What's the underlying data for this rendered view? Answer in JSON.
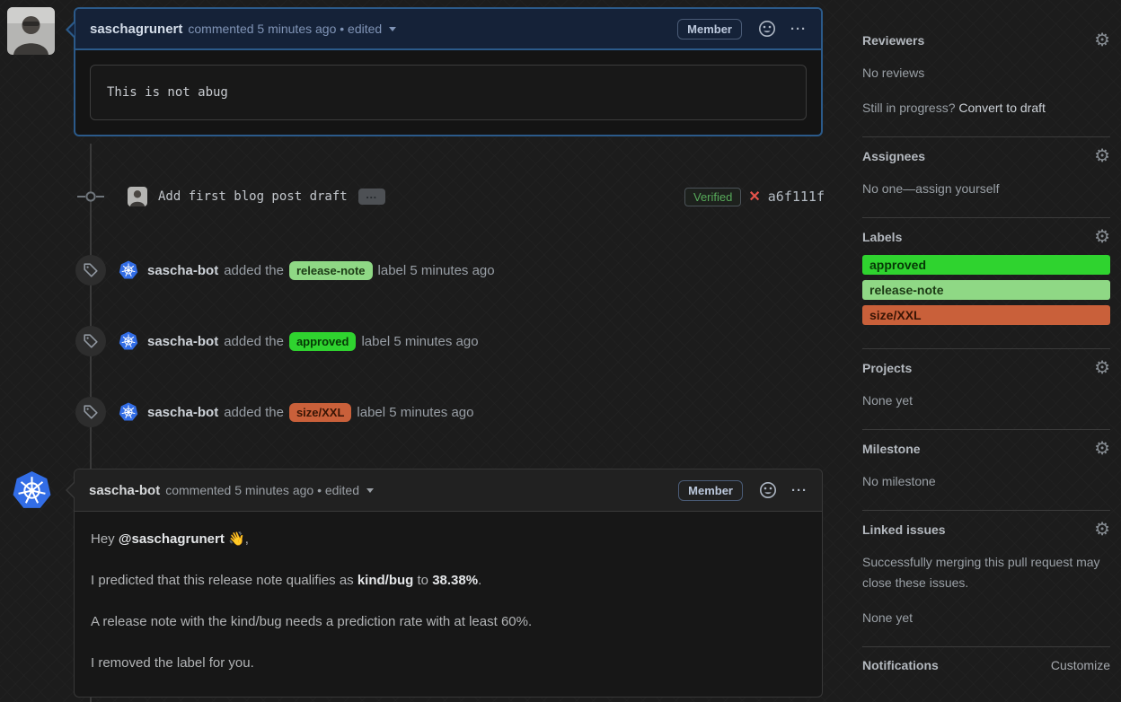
{
  "colors": {
    "highlight_border": "#2b5a8a",
    "k8s_blue": "#326de6",
    "verified_green": "#57ab5a",
    "error_red": "#e5534b"
  },
  "icons": {
    "gear": "⚙",
    "kebab": "···",
    "expander": "…",
    "status_x": "✕"
  },
  "comment1": {
    "author": "saschagrunert",
    "meta": "commented 5 minutes ago • edited",
    "badge": "Member",
    "code": "This is not abug"
  },
  "commit": {
    "message": "Add first blog post draft",
    "verified_label": "Verified",
    "sha": "a6f111f"
  },
  "events": [
    {
      "actor": "sascha-bot",
      "action": "added the",
      "label": "release-note",
      "suffix": "label 5 minutes ago",
      "label_style": "background:#8fd885;color:#1c3a15"
    },
    {
      "actor": "sascha-bot",
      "action": "added the",
      "label": "approved",
      "suffix": "label 5 minutes ago",
      "label_style": "background:#2fd32f;color:#063806"
    },
    {
      "actor": "sascha-bot",
      "action": "added the",
      "label": "size/XXL",
      "suffix": "label 5 minutes ago",
      "label_style": "background:#c9603a;color:#391505"
    }
  ],
  "comment2": {
    "author": "sascha-bot",
    "meta": "commented 5 minutes ago • edited",
    "badge": "Member",
    "p1_pre": "Hey ",
    "p1_mention": "@saschagrunert",
    "p1_emoji": " 👋",
    "p1_post": ",",
    "p2_a": "I predicted that this release note qualifies as ",
    "p2_b": "kind/bug",
    "p2_c": " to ",
    "p2_d": "38.38%",
    "p2_e": ".",
    "p3": "A release note with the kind/bug needs a prediction rate with at least 60%.",
    "p4": "I removed the label for you."
  },
  "sidebar": {
    "reviewers": {
      "title": "Reviewers",
      "empty": "No reviews",
      "prompt": "Still in progress? ",
      "link": "Convert to draft"
    },
    "assignees": {
      "title": "Assignees",
      "empty_pre": "No one—",
      "empty_link": "assign yourself"
    },
    "labels": {
      "title": "Labels",
      "items": [
        {
          "name": "approved",
          "style": "background:#2fd32f;color:#063806"
        },
        {
          "name": "release-note",
          "style": "background:#8fd885;color:#1c3a15"
        },
        {
          "name": "size/XXL",
          "style": "background:#c9603a;color:#391505"
        }
      ]
    },
    "projects": {
      "title": "Projects",
      "empty": "None yet"
    },
    "milestone": {
      "title": "Milestone",
      "empty": "No milestone"
    },
    "linked_issues": {
      "title": "Linked issues",
      "description": "Successfully merging this pull request may close these issues.",
      "empty": "None yet"
    },
    "notifications": {
      "title": "Notifications",
      "link": "Customize"
    }
  }
}
